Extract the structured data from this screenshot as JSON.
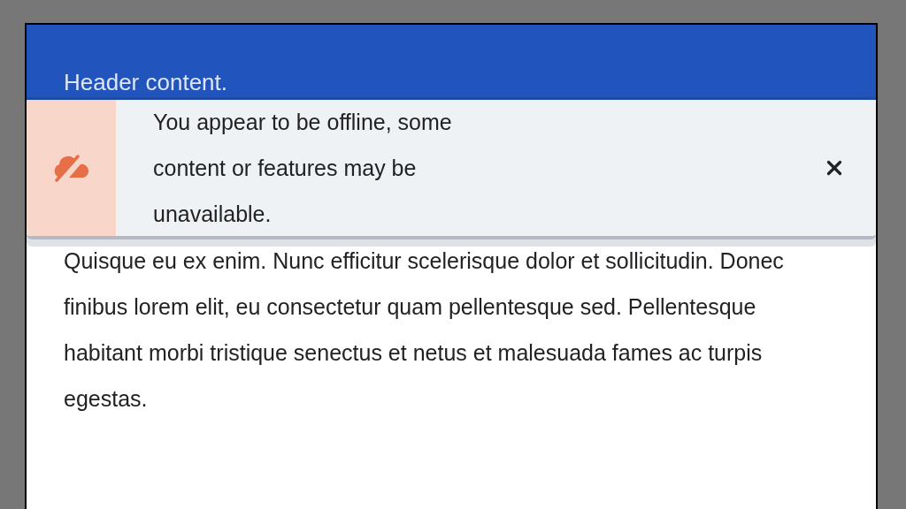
{
  "header": {
    "text": "Header content."
  },
  "banner": {
    "message": "You appear to be offline, some content or features may be unavailable."
  },
  "body": {
    "paragraph": "Quisque eu ex enim. Nunc efficitur scelerisque dolor et sollicitudin. Donec finibus lorem elit, eu consectetur quam pellentesque sed. Pellentesque habitant morbi tristique senectus et netus et malesuada fames ac turpis egestas."
  }
}
